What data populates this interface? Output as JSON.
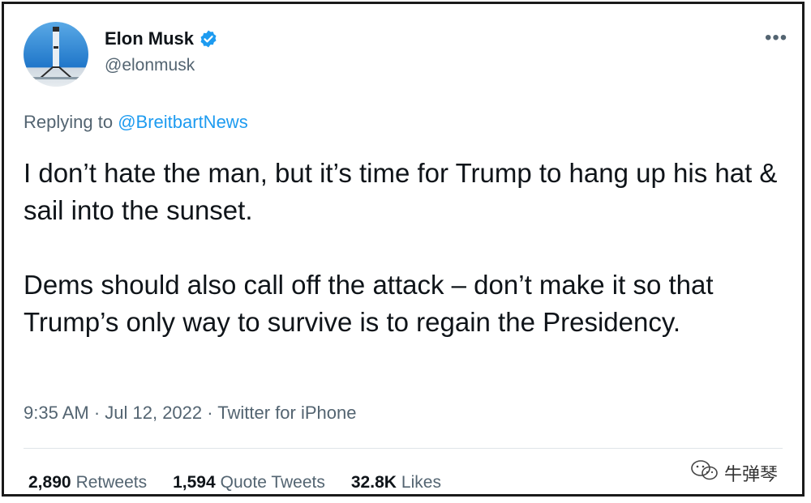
{
  "user": {
    "display_name": "Elon Musk",
    "handle": "@elonmusk",
    "verified": true,
    "avatar_icon": "rocket-launch-avatar",
    "verified_icon": "verified-badge-icon"
  },
  "menu": {
    "more_label": "•••"
  },
  "reply": {
    "prefix": "Replying to",
    "mention": "@BreitbartNews"
  },
  "tweet": {
    "paragraphs": [
      "I don’t hate the man, but it’s time for Trump to hang up his hat & sail into the sunset.",
      "Dems should also call off the attack – don’t make it so that Trump’s only way to survive is to regain the Presidency."
    ]
  },
  "meta": {
    "text": "9:35 AM · Jul 12, 2022 · Twitter for iPhone"
  },
  "stats": [
    {
      "count": "2,890",
      "label": "Retweets"
    },
    {
      "count": "1,594",
      "label": "Quote Tweets"
    },
    {
      "count": "32.8K",
      "label": "Likes"
    }
  ],
  "watermark": {
    "text": "牛弹琴",
    "icon": "wechat-logo-icon"
  },
  "colors": {
    "link": "#1d9bf0",
    "secondary": "#536471",
    "text": "#0f1419"
  }
}
